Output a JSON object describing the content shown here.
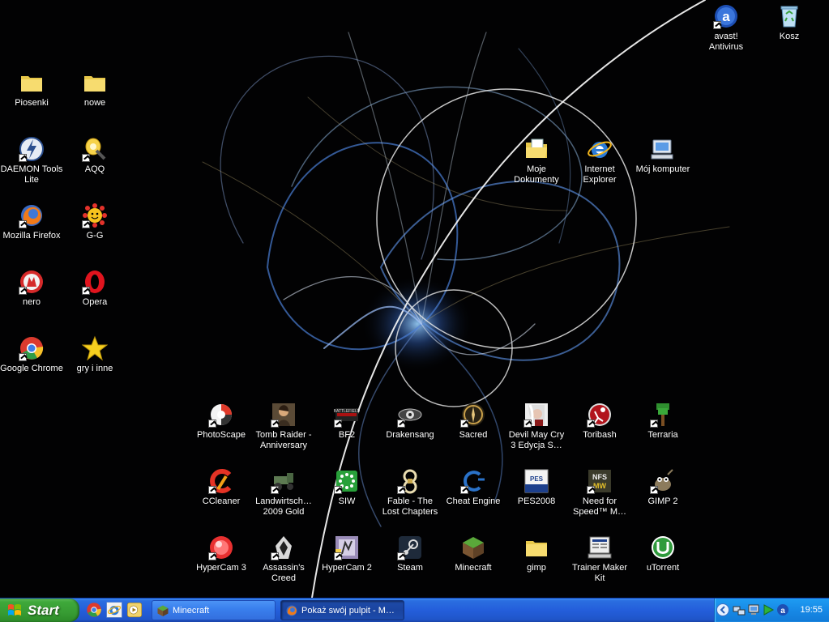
{
  "desktop": {
    "icons": [
      {
        "id": "avast",
        "label": "avast!\nAntivirus",
        "shortcut": true
      },
      {
        "id": "kosz",
        "label": "Kosz",
        "shortcut": false
      },
      {
        "id": "piosenki",
        "label": "Piosenki",
        "shortcut": false
      },
      {
        "id": "nowe",
        "label": "nowe",
        "shortcut": false
      },
      {
        "id": "daemon",
        "label": "DAEMON Tools\nLite",
        "shortcut": true
      },
      {
        "id": "aqq",
        "label": "AQQ",
        "shortcut": true
      },
      {
        "id": "firefox",
        "label": "Mozilla Firefox",
        "shortcut": true
      },
      {
        "id": "gg",
        "label": "G-G",
        "shortcut": true
      },
      {
        "id": "nero",
        "label": "nero",
        "shortcut": true
      },
      {
        "id": "opera",
        "label": "Opera",
        "shortcut": true
      },
      {
        "id": "chrome",
        "label": "Google Chrome",
        "shortcut": true
      },
      {
        "id": "gry",
        "label": "gry i inne",
        "shortcut": false
      },
      {
        "id": "moje",
        "label": "Moje\nDokumenty",
        "shortcut": false
      },
      {
        "id": "ie",
        "label": "Internet\nExplorer",
        "shortcut": false
      },
      {
        "id": "mojkomp",
        "label": "Mój komputer",
        "shortcut": false
      },
      {
        "id": "photoscape",
        "label": "PhotoScape",
        "shortcut": true
      },
      {
        "id": "tombraider",
        "label": "Tomb Raider -\nAnniversary",
        "shortcut": true
      },
      {
        "id": "bf2",
        "label": "BF2",
        "shortcut": true
      },
      {
        "id": "drakensang",
        "label": "Drakensang",
        "shortcut": true
      },
      {
        "id": "sacred",
        "label": "Sacred",
        "shortcut": true
      },
      {
        "id": "dmc",
        "label": "Devil May Cry\n3 Edycja S…",
        "shortcut": true
      },
      {
        "id": "toribash",
        "label": "Toribash",
        "shortcut": true
      },
      {
        "id": "terraria",
        "label": "Terraria",
        "shortcut": true
      },
      {
        "id": "ccleaner",
        "label": "CCleaner",
        "shortcut": true
      },
      {
        "id": "landwirt",
        "label": "Landwirtsch…\n2009 Gold",
        "shortcut": true
      },
      {
        "id": "siw",
        "label": "SIW",
        "shortcut": true
      },
      {
        "id": "fable",
        "label": "Fable - The\nLost Chapters",
        "shortcut": true
      },
      {
        "id": "cheat",
        "label": "Cheat Engine",
        "shortcut": true
      },
      {
        "id": "pes",
        "label": "PES2008",
        "shortcut": false
      },
      {
        "id": "nfs",
        "label": "Need for\nSpeed™ M…",
        "shortcut": true
      },
      {
        "id": "gimp2",
        "label": "GIMP 2",
        "shortcut": true
      },
      {
        "id": "hypercam3",
        "label": "HyperCam 3",
        "shortcut": true
      },
      {
        "id": "assassin",
        "label": "Assassin's\nCreed",
        "shortcut": true
      },
      {
        "id": "hypercam2",
        "label": "HyperCam 2",
        "shortcut": true
      },
      {
        "id": "steam",
        "label": "Steam",
        "shortcut": true
      },
      {
        "id": "minecraft",
        "label": "Minecraft",
        "shortcut": false
      },
      {
        "id": "gimpfolder",
        "label": "gimp",
        "shortcut": false
      },
      {
        "id": "trainer",
        "label": "Trainer Maker\nKit",
        "shortcut": false
      },
      {
        "id": "utorrent",
        "label": "uTorrent",
        "shortcut": false
      }
    ]
  },
  "taskbar": {
    "start_label": "Start",
    "quicklaunch": [
      "chrome-icon",
      "ie-icon",
      "media-player-icon"
    ],
    "tasks": [
      {
        "label": "Minecraft",
        "active": false
      },
      {
        "label": "Pokaż swój pulpit - M…",
        "active": true
      }
    ],
    "clock": "19:55"
  },
  "colors": {
    "taskbar_blue": "#245edb",
    "start_green": "#379c33",
    "tray_blue": "#1789e6"
  }
}
